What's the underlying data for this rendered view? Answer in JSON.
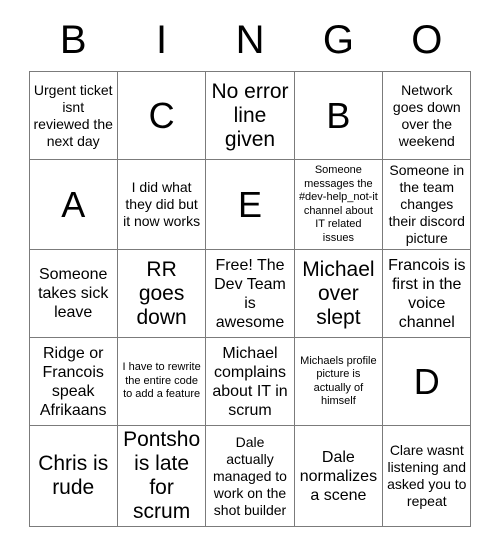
{
  "card": {
    "title": "BINGO",
    "headers": [
      "B",
      "I",
      "N",
      "G",
      "O"
    ],
    "grid_colors": {
      "background": "#ffffff",
      "text": "#000000",
      "border": "#7b7b7b"
    },
    "rows": [
      [
        {
          "text": "Urgent ticket isnt reviewed the next day",
          "size": "sz-sm"
        },
        {
          "text": "C",
          "size": "sz-xl"
        },
        {
          "text": "No error line given",
          "size": "sz-lg"
        },
        {
          "text": "B",
          "size": "sz-xl"
        },
        {
          "text": "Network goes down over the weekend",
          "size": "sz-sm"
        }
      ],
      [
        {
          "text": "A",
          "size": "sz-xl"
        },
        {
          "text": "I did what they did but it now works",
          "size": "sz-sm"
        },
        {
          "text": "E",
          "size": "sz-xl"
        },
        {
          "text": "Someone messages the #dev-help_not-it channel about IT related issues",
          "size": "sz-xs"
        },
        {
          "text": "Someone in the team changes their discord picture",
          "size": "sz-sm"
        }
      ],
      [
        {
          "text": "Someone takes sick leave",
          "size": "sz-md"
        },
        {
          "text": "RR goes down",
          "size": "sz-lg"
        },
        {
          "text": "Free! The Dev Team is awesome",
          "size": "sz-md"
        },
        {
          "text": "Michael over slept",
          "size": "sz-lg"
        },
        {
          "text": "Francois is first in the voice channel",
          "size": "sz-md"
        }
      ],
      [
        {
          "text": "Ridge or Francois speak Afrikaans",
          "size": "sz-md"
        },
        {
          "text": "I have to rewrite the entire code to add a feature",
          "size": "sz-xs"
        },
        {
          "text": "Michael complains about IT in scrum",
          "size": "sz-md"
        },
        {
          "text": "Michaels profile picture is actually of himself",
          "size": "sz-xs"
        },
        {
          "text": "D",
          "size": "sz-xl"
        }
      ],
      [
        {
          "text": "Chris is rude",
          "size": "sz-lg"
        },
        {
          "text": "Pontsho is late for scrum",
          "size": "sz-lg"
        },
        {
          "text": "Dale actually managed to work on the shot builder",
          "size": "sz-sm"
        },
        {
          "text": "Dale normalizes a scene",
          "size": "sz-md"
        },
        {
          "text": "Clare wasnt listening and asked you to repeat",
          "size": "sz-sm"
        }
      ]
    ]
  }
}
